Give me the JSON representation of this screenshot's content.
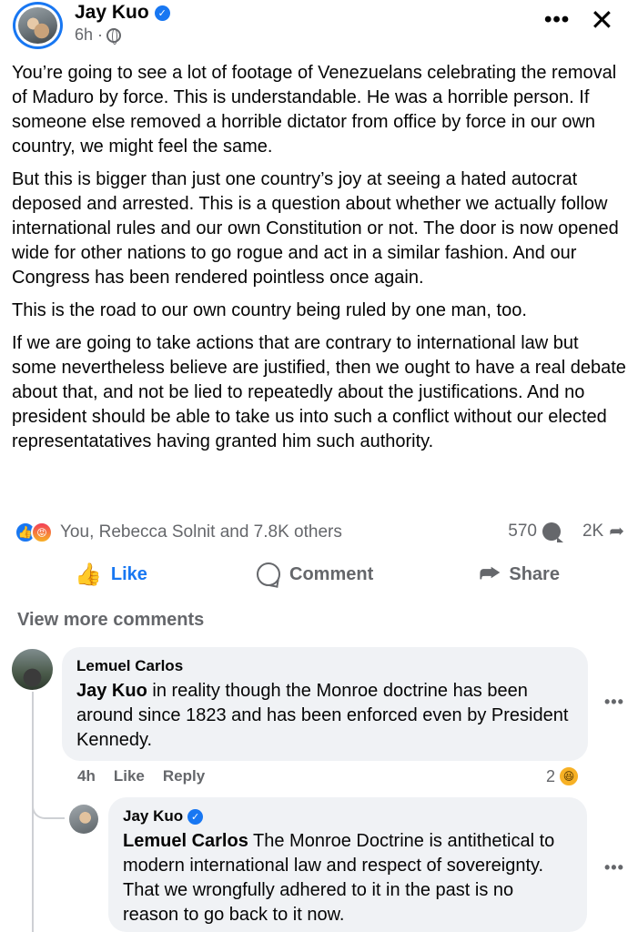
{
  "post": {
    "author": "Jay Kuo",
    "time": "6h ·",
    "paragraphs": [
      "You’re going to see a lot of footage of Venezuelans celebrating the removal of Maduro by force. This is understandable. He was a horrible person. If someone else removed a horrible dictator from office by force in our own country, we might feel the same.",
      "But this is bigger than just one country’s joy at seeing a hated autocrat deposed and arrested. This is a question about whether we actually follow international rules and our own Constitution or not. The door is now opened wide for other nations to go rogue and act in a similar fashion. And our Congress has been rendered pointless once again.",
      "This is the road to our own country being ruled by one man, too.",
      "If we are going to take actions that are contrary to international law but some nevertheless believe are justified, then we ought to have a real debate about that, and not be lied to repeatedly about the justifications. And no president should be able to take us into such a conflict without our elected representatatives having granted him such authority."
    ],
    "reactions_text": "You, Rebecca Solnit and 7.8K others",
    "comment_count": "570",
    "share_count": "2K",
    "more_glyph": "•••",
    "close_glyph": "✕"
  },
  "actions": {
    "like": "Like",
    "comment": "Comment",
    "share": "Share"
  },
  "comments": {
    "view_more": "View more comments",
    "c1": {
      "name": "Lemuel Carlos",
      "tag": "Jay Kuo",
      "text": " in reality though the Monroe doctrine has been around since 1823 and has been enforced even by President Kennedy.",
      "time": "4h",
      "like": "Like",
      "reply": "Reply",
      "reaction_count": "2"
    },
    "c2": {
      "name": "Jay Kuo",
      "tag": "Lemuel Carlos",
      "text": " The Monroe Doctrine is antithetical to modern international law and respect of sovereignty. That we wrongfully adhered to it in the past is no reason to go back to it now."
    },
    "more_glyph": "•••"
  },
  "colors": {
    "brand": "#1877f2",
    "muted": "#65676b",
    "bubble": "#f0f2f5"
  }
}
